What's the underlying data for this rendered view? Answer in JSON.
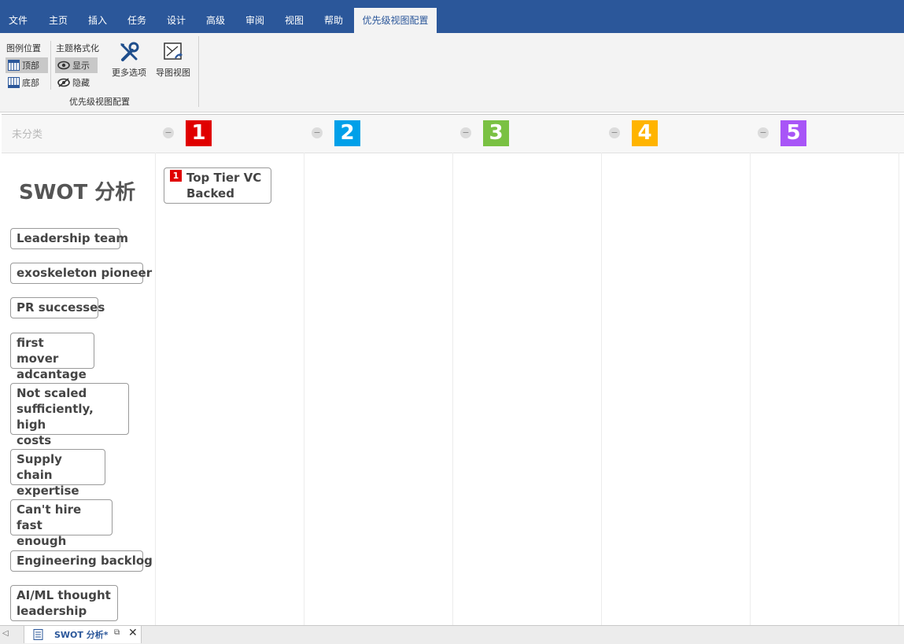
{
  "menu": {
    "tabs": [
      {
        "label": "文件"
      },
      {
        "label": "主页"
      },
      {
        "label": "插入"
      },
      {
        "label": "任务"
      },
      {
        "label": "设计"
      },
      {
        "label": "高级"
      },
      {
        "label": "审阅"
      },
      {
        "label": "视图"
      },
      {
        "label": "帮助"
      },
      {
        "label": "优先级视图配置",
        "active": true
      }
    ]
  },
  "ribbon": {
    "legend_position": {
      "label": "图例位置",
      "top": "顶部",
      "bottom": "底部",
      "selected": "top"
    },
    "topic_format": {
      "label": "主题格式化",
      "show": "显示",
      "hide": "隐藏",
      "selected": "show"
    },
    "more_options": "更多选项",
    "map_view": "导图视图",
    "group_label": "优先级视图配置"
  },
  "board": {
    "uncategorized_label": "未分类",
    "priorities": [
      {
        "label": "1",
        "color": "#e00000"
      },
      {
        "label": "2",
        "color": "#00a0e9"
      },
      {
        "label": "3",
        "color": "#7ac143"
      },
      {
        "label": "4",
        "color": "#ffb400"
      },
      {
        "label": "5",
        "color": "#a855f7"
      }
    ],
    "title": "SWOT 分析",
    "uncategorized_topics": [
      {
        "text": "Leadership team"
      },
      {
        "text": "exoskeleton pioneer"
      },
      {
        "text": "PR successes"
      },
      {
        "text": "first mover\nadcantage"
      },
      {
        "text": "Not scaled\nsufficiently, high\ncosts"
      },
      {
        "text": "Supply chain\nexpertise"
      },
      {
        "text": "Can't hire fast\nenough"
      },
      {
        "text": "Engineering backlog"
      },
      {
        "text": "AI/ML thought\nleadership"
      }
    ],
    "priority1_topics": [
      {
        "badge": "1",
        "text": "Top Tier VC\nBacked"
      }
    ]
  },
  "doc_tabs": [
    {
      "label": "SWOT 分析*",
      "icon": "mindmap-file-icon"
    }
  ],
  "colors": {
    "menubar": "#2b579a",
    "ribbon": "#f3f3f3"
  }
}
